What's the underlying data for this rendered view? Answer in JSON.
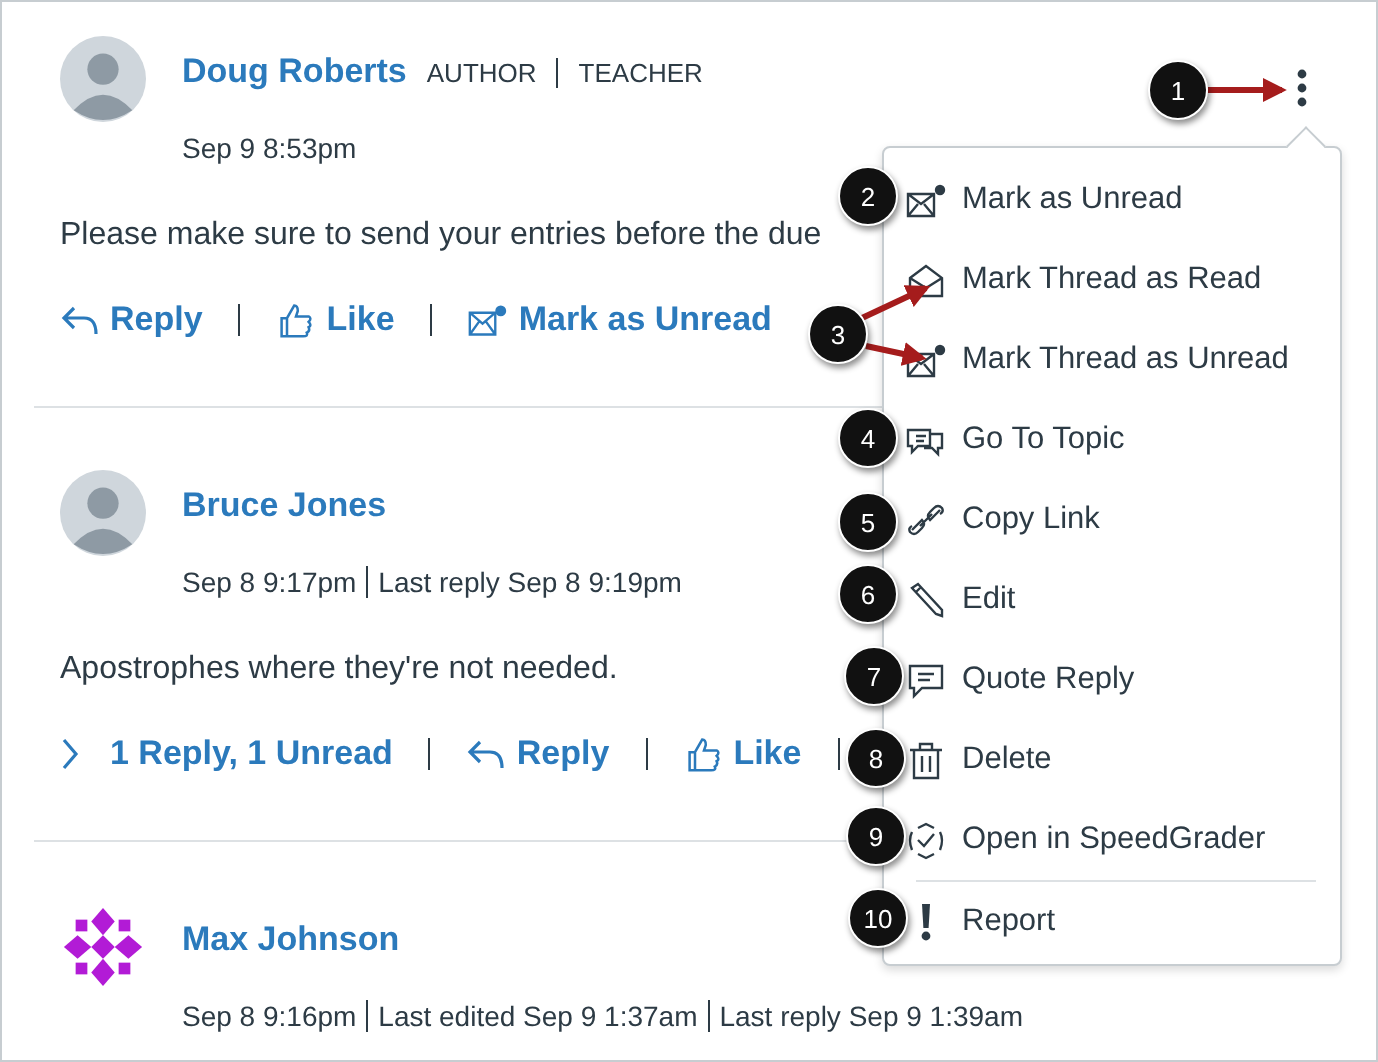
{
  "posts": [
    {
      "avatar": {
        "kind": "photo"
      },
      "author": "Doug Roberts",
      "roles": [
        "AUTHOR",
        "TEACHER"
      ],
      "meta": [
        "Sep 9 8:53pm"
      ],
      "body": "Please make sure to send your entries before the due",
      "actions": [
        {
          "kind": "reply",
          "label": "Reply"
        },
        {
          "kind": "like",
          "label": "Like"
        },
        {
          "kind": "mark-unread",
          "label": "Mark as Unread"
        }
      ]
    },
    {
      "avatar": {
        "kind": "photo"
      },
      "author": "Bruce Jones",
      "meta": [
        "Sep 8 9:17pm",
        "Last reply Sep 8 9:19pm"
      ],
      "body": "Apostrophes where they're not needed.",
      "actions": [
        {
          "kind": "replies",
          "label": "1 Reply, 1 Unread"
        },
        {
          "kind": "reply",
          "label": "Reply"
        },
        {
          "kind": "like",
          "label": "Like"
        }
      ],
      "trailing_separator": true
    },
    {
      "avatar": {
        "kind": "pattern"
      },
      "author": "Max Johnson",
      "meta": [
        "Sep 8 9:16pm",
        "Last edited Sep 9 1:37am",
        "Last reply Sep 9 1:39am"
      ]
    }
  ],
  "menu": {
    "items": [
      {
        "kind": "mark-unread",
        "label": "Mark as Unread"
      },
      {
        "kind": "mark-read",
        "label": "Mark Thread as Read"
      },
      {
        "kind": "mark-unread",
        "label": "Mark Thread as Unread"
      },
      {
        "kind": "topic",
        "label": "Go To Topic"
      },
      {
        "kind": "link",
        "label": "Copy Link"
      },
      {
        "kind": "edit",
        "label": "Edit"
      },
      {
        "kind": "quote",
        "label": "Quote Reply"
      },
      {
        "kind": "delete",
        "label": "Delete"
      },
      {
        "kind": "speedgrader",
        "label": "Open in SpeedGrader"
      },
      {
        "kind": "report",
        "label": "Report",
        "divider_above": true
      }
    ]
  },
  "callouts": [
    {
      "label": "1"
    },
    {
      "label": "2"
    },
    {
      "label": "3"
    },
    {
      "label": "4"
    },
    {
      "label": "5"
    },
    {
      "label": "6"
    },
    {
      "label": "7"
    },
    {
      "label": "8"
    },
    {
      "label": "9"
    },
    {
      "label": "10"
    }
  ]
}
